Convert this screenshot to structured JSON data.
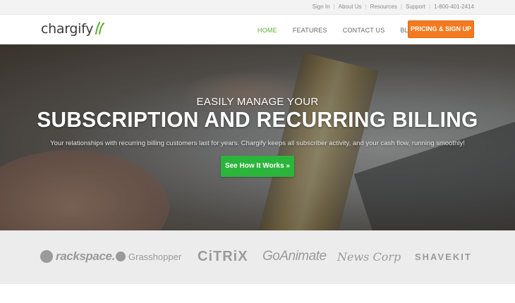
{
  "utility": {
    "links": [
      "Sign In",
      "About Us",
      "Resources",
      "Support"
    ],
    "phone": "1-800-401-2414"
  },
  "header": {
    "logo": "chargify",
    "nav": [
      "HOME",
      "FEATURES",
      "CONTACT US",
      "BLOG"
    ],
    "cta": "PRICING & SIGN UP",
    "colors": {
      "active": "#5cae34",
      "cta": "#f47a20"
    }
  },
  "hero": {
    "eyebrow": "EASILY MANAGE YOUR",
    "title": "SUBSCRIPTION AND RECURRING BILLING",
    "subtitle": "Your relationships with recurring billing customers last for years. Chargify keeps all subscriber activity, and your cash flow, running smoothly!",
    "button": "See How It Works »",
    "button_color": "#2bb53b"
  },
  "clients": [
    "rackspace.",
    "Grasshopper",
    "CiTRiX",
    "GoAnimate",
    "News Corp",
    "SHAVEKIT"
  ]
}
